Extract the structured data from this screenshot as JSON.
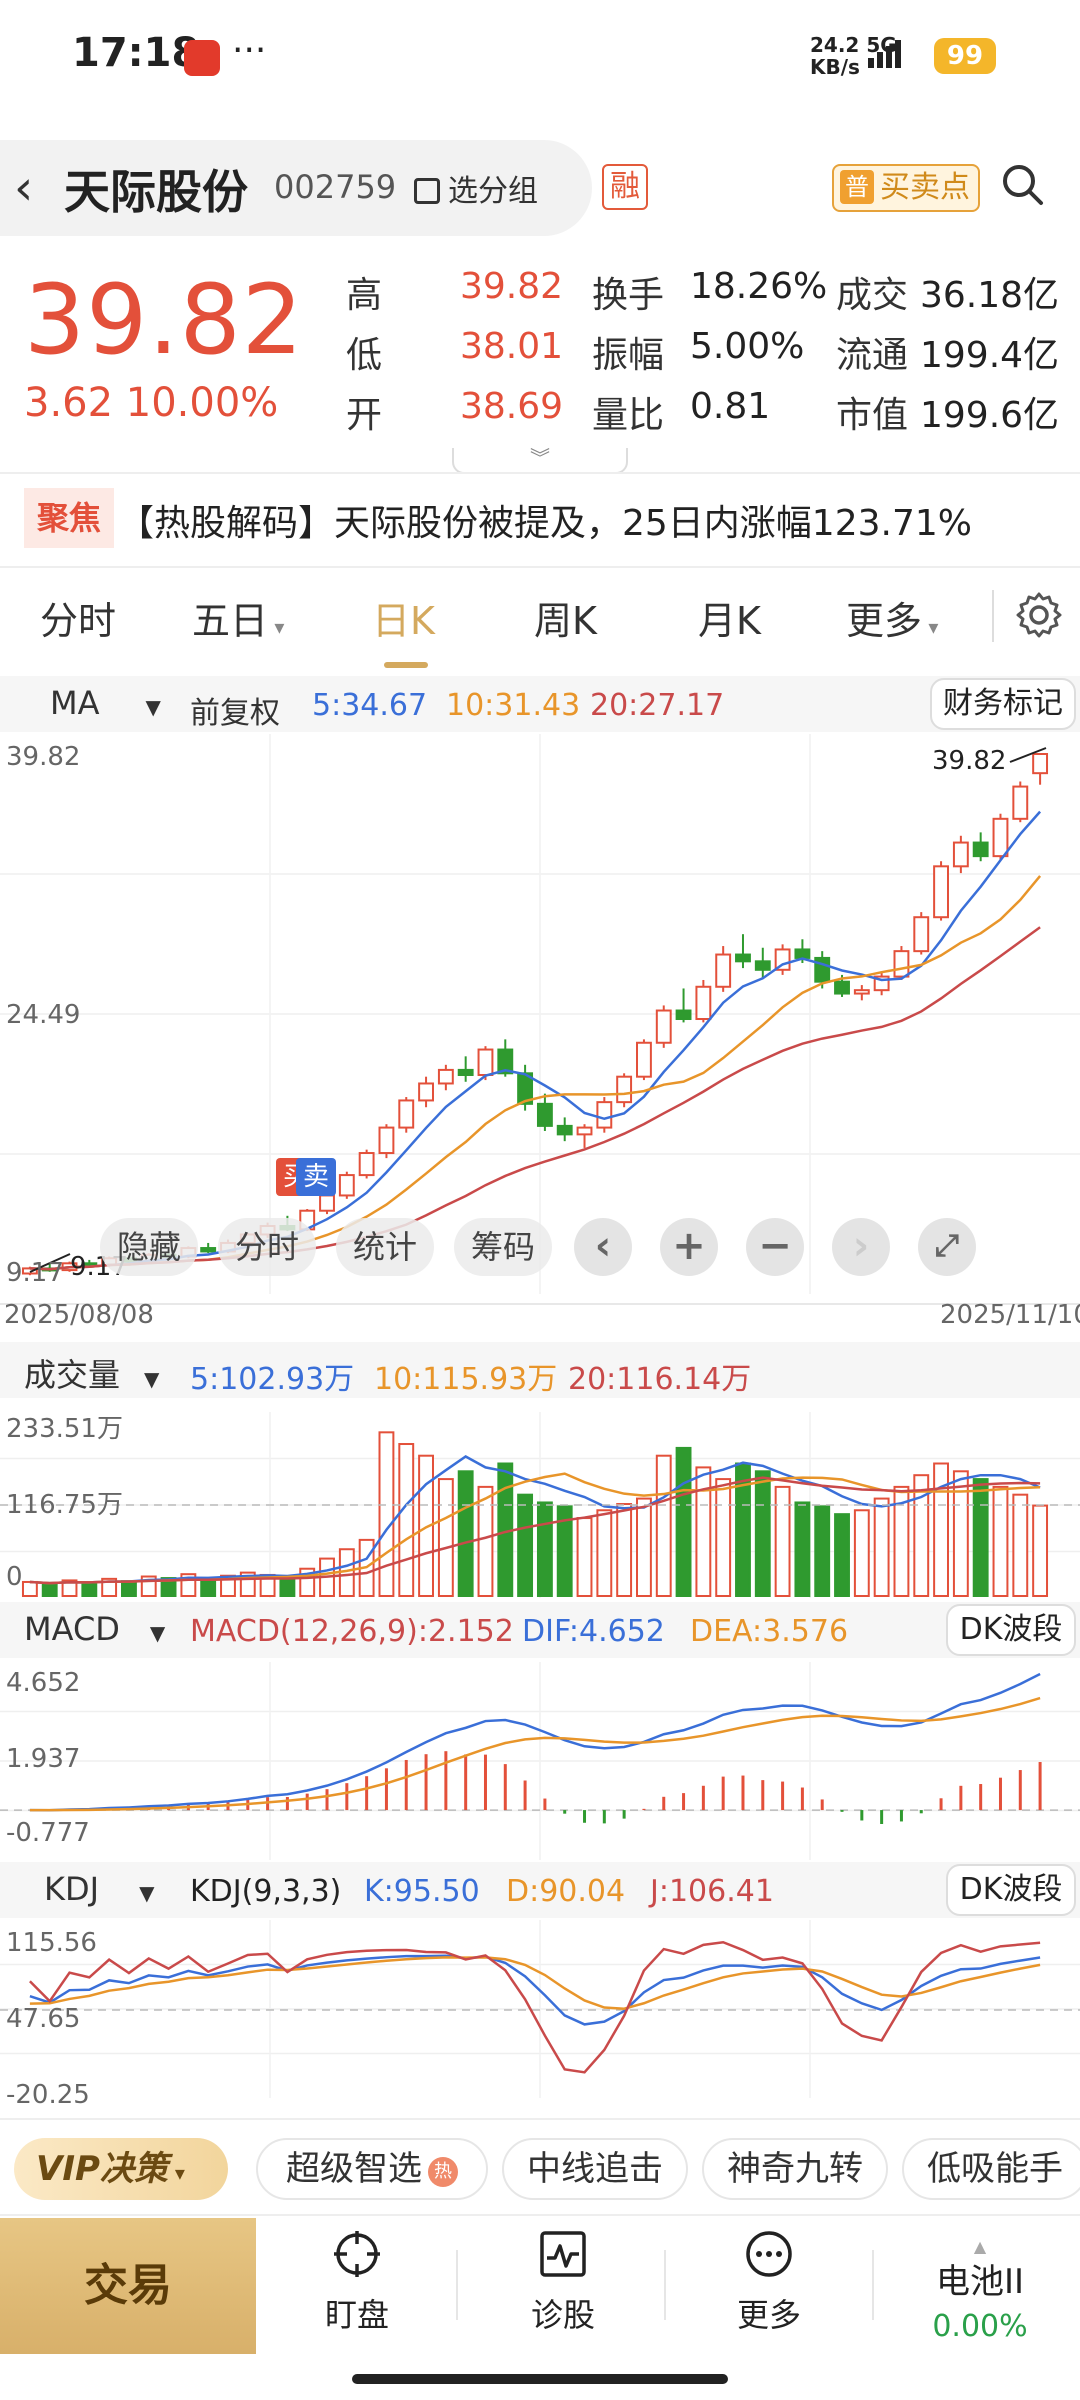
{
  "status": {
    "time": "17:18",
    "dots": "···",
    "net_speed": "24.2",
    "net_unit": "KB/s",
    "net_type": "5G",
    "battery": "99"
  },
  "header": {
    "stock_name": "天际股份",
    "stock_code": "002759",
    "select_group": "选分组",
    "margin_badge": "融",
    "buy_sell_tag": "普",
    "buy_sell": "买卖点"
  },
  "quote": {
    "price": "39.82",
    "change": "3.62",
    "change_pct": "10.00%",
    "rows": [
      {
        "l1": "高",
        "v1": "39.82",
        "l2": "换手",
        "v2": "18.26%",
        "l3": "成交",
        "v3": "36.18亿"
      },
      {
        "l1": "低",
        "v1": "38.01",
        "l2": "振幅",
        "v2": "5.00%",
        "l3": "流通",
        "v3": "199.4亿"
      },
      {
        "l1": "开",
        "v1": "38.69",
        "l2": "量比",
        "v2": "0.81",
        "l3": "市值",
        "v3": "199.6亿"
      }
    ]
  },
  "news": {
    "tag": "聚焦",
    "text": "【热股解码】天际股份被提及，25日内涨幅123.71%"
  },
  "tabs": [
    "分时",
    "五日",
    "日K",
    "周K",
    "月K",
    "更多"
  ],
  "active_tab": "日K",
  "kline": {
    "ma_label": "MA",
    "adjust": "前复权",
    "ma5": "5:34.67",
    "ma10": "10:31.43",
    "ma20": "20:27.17",
    "finance_btn": "财务标记",
    "y_top": "39.82",
    "y_mid": "24.49",
    "y_bot": "9.17",
    "high_mark": "39.82",
    "low_mark": "9.17",
    "date_start": "2025/08/08",
    "date_end": "2025/11/10",
    "buy_marker": "买",
    "sell_marker": "卖",
    "overlay": {
      "hide": "隐藏",
      "timeshare": "分时",
      "stats": "统计",
      "chips": "筹码"
    }
  },
  "volume": {
    "label": "成交量",
    "ma5": "5:102.93万",
    "ma10": "10:115.93万",
    "ma20": "20:116.14万",
    "y_top": "233.51万",
    "y_mid": "116.75万",
    "y_bot": "0"
  },
  "macd": {
    "label": "MACD",
    "macd": "MACD(12,26,9):2.152",
    "dif": "DIF:4.652",
    "dea": "DEA:3.576",
    "btn": "DK波段",
    "y_top": "4.652",
    "y_mid": "1.937",
    "y_bot": "-0.777"
  },
  "kdj": {
    "label": "KDJ",
    "name": "KDJ(9,3,3)",
    "k": "K:95.50",
    "d": "D:90.04",
    "j": "J:106.41",
    "btn": "DK波段",
    "y_top": "115.56",
    "y_mid": "47.65",
    "y_bot": "-20.25"
  },
  "quick": {
    "vip": "VIP决策",
    "tags": [
      "超级智选",
      "中线追击",
      "神奇九转",
      "低吸能手"
    ]
  },
  "nav": {
    "trade": "交易",
    "watch": "盯盘",
    "diagnose": "诊股",
    "more": "更多",
    "battery_name": "电池II",
    "battery_pct": "0.00%"
  },
  "colors": {
    "up": "#e3503a",
    "down": "#2f9a2f",
    "ma5": "#3a6fd8",
    "ma10": "#e8952a",
    "ma20": "#c94a4a",
    "accent": "#d4a95e"
  },
  "chart_data": {
    "type": "candlestick",
    "title": "",
    "x_range": [
      "2025/08/08",
      "2025/11/10"
    ],
    "ylim": [
      9.17,
      39.82
    ],
    "candles": [
      [
        9.2,
        9.6,
        9.1,
        9.5
      ],
      [
        9.5,
        9.8,
        9.3,
        9.4
      ],
      [
        9.4,
        9.9,
        9.3,
        9.8
      ],
      [
        9.8,
        10.0,
        9.6,
        9.7
      ],
      [
        9.7,
        10.2,
        9.6,
        10.1
      ],
      [
        10.1,
        10.3,
        9.8,
        9.9
      ],
      [
        9.9,
        10.4,
        9.8,
        10.3
      ],
      [
        10.3,
        10.6,
        10.0,
        10.2
      ],
      [
        10.2,
        10.8,
        10.1,
        10.7
      ],
      [
        10.7,
        11.0,
        10.4,
        10.5
      ],
      [
        10.5,
        11.2,
        10.4,
        11.0
      ],
      [
        11.0,
        11.6,
        10.9,
        11.5
      ],
      [
        11.5,
        12.2,
        11.3,
        12.0
      ],
      [
        12.0,
        12.6,
        11.7,
        11.8
      ],
      [
        11.8,
        13.0,
        11.7,
        12.9
      ],
      [
        12.9,
        14.0,
        12.7,
        13.8
      ],
      [
        13.8,
        15.2,
        13.6,
        15.0
      ],
      [
        15.0,
        16.5,
        14.8,
        16.3
      ],
      [
        16.3,
        18.0,
        16.0,
        17.8
      ],
      [
        17.8,
        19.6,
        17.5,
        19.4
      ],
      [
        19.4,
        20.8,
        19.0,
        20.4
      ],
      [
        20.4,
        21.5,
        20.0,
        21.2
      ],
      [
        21.2,
        22.0,
        20.5,
        20.9
      ],
      [
        20.9,
        22.6,
        20.6,
        22.4
      ],
      [
        22.4,
        23.0,
        20.8,
        21.0
      ],
      [
        21.0,
        21.5,
        18.8,
        19.2
      ],
      [
        19.2,
        19.8,
        17.6,
        17.9
      ],
      [
        17.9,
        18.4,
        17.0,
        17.4
      ],
      [
        17.4,
        18.0,
        16.6,
        17.8
      ],
      [
        17.8,
        19.6,
        17.5,
        19.3
      ],
      [
        19.3,
        21.0,
        19.0,
        20.8
      ],
      [
        20.8,
        23.0,
        20.6,
        22.8
      ],
      [
        22.8,
        25.0,
        22.5,
        24.7
      ],
      [
        24.7,
        26.0,
        24.0,
        24.2
      ],
      [
        24.2,
        26.5,
        24.0,
        26.1
      ],
      [
        26.1,
        28.5,
        25.8,
        28.0
      ],
      [
        28.0,
        29.2,
        27.2,
        27.6
      ],
      [
        27.6,
        28.4,
        26.6,
        27.1
      ],
      [
        27.1,
        28.6,
        26.8,
        28.3
      ],
      [
        28.3,
        28.9,
        27.5,
        27.8
      ],
      [
        27.8,
        28.2,
        26.0,
        26.4
      ],
      [
        26.4,
        26.8,
        25.5,
        25.7
      ],
      [
        25.7,
        26.2,
        25.3,
        25.9
      ],
      [
        25.9,
        27.0,
        25.6,
        26.7
      ],
      [
        26.7,
        28.5,
        26.5,
        28.2
      ],
      [
        28.2,
        30.5,
        28.0,
        30.2
      ],
      [
        30.2,
        33.5,
        30.0,
        33.2
      ],
      [
        33.2,
        35.0,
        32.8,
        34.6
      ],
      [
        34.6,
        35.2,
        33.5,
        33.8
      ],
      [
        33.8,
        36.3,
        33.6,
        36.0
      ],
      [
        36.0,
        38.2,
        35.8,
        37.9
      ],
      [
        38.69,
        39.82,
        38.01,
        39.82
      ]
    ],
    "volume_ylim": [
      0,
      233.51
    ],
    "volume": [
      18,
      15,
      20,
      17,
      22,
      19,
      25,
      23,
      28,
      21,
      26,
      30,
      27,
      24,
      35,
      48,
      60,
      72,
      210,
      195,
      180,
      150,
      160,
      140,
      170,
      130,
      120,
      115,
      100,
      110,
      118,
      125,
      180,
      190,
      165,
      150,
      170,
      160,
      140,
      120,
      115,
      105,
      110,
      125,
      140,
      155,
      170,
      160,
      150,
      140,
      130,
      116
    ],
    "macd_ylim": [
      -0.777,
      4.652
    ],
    "kdj_ylim": [
      -20.25,
      115.56
    ]
  }
}
